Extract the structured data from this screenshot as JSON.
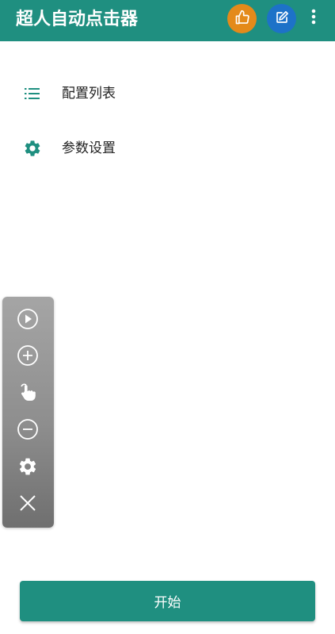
{
  "app_bar": {
    "title": "超人自动点击器",
    "background_color": "#1f8f80",
    "like_button_color": "#e48a1a",
    "edit_button_color": "#1d72c8",
    "icons": [
      "thumbs-up-icon",
      "edit-icon",
      "more-vert-icon"
    ]
  },
  "menu": {
    "items": [
      {
        "label": "配置列表",
        "icon": "list-icon"
      },
      {
        "label": "参数设置",
        "icon": "gear-icon"
      }
    ]
  },
  "floating_panel": {
    "buttons": [
      "play-icon",
      "add-circle-icon",
      "tap-gesture-icon",
      "remove-circle-icon",
      "gear-icon",
      "close-icon"
    ]
  },
  "start_button": {
    "label": "开始",
    "color": "#1f8f80"
  }
}
